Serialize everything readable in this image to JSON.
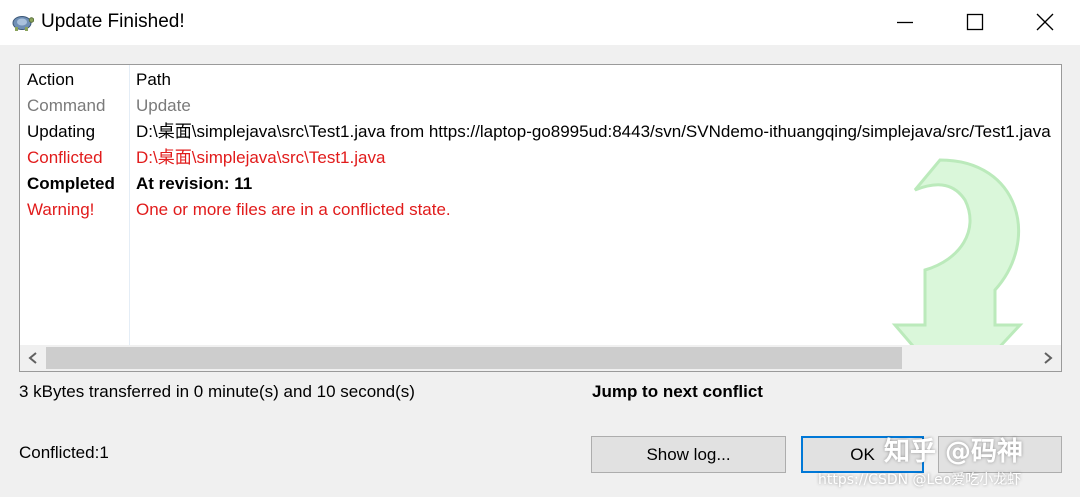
{
  "window": {
    "title": "Update Finished!",
    "controls": {
      "minimize": "minimize-icon",
      "maximize": "maximize-icon",
      "close": "close-icon"
    }
  },
  "list": {
    "headers": {
      "action": "Action",
      "path": "Path"
    },
    "rows": [
      {
        "action": "Command",
        "path": "Update",
        "color": "#7a7a7a",
        "bold": false
      },
      {
        "action": "Updating",
        "path": "D:\\桌面\\simplejava\\src\\Test1.java from https://laptop-go8995ud:8443/svn/SVNdemo-ithuangqing/simplejava/src/Test1.java",
        "color": "#000000",
        "bold": false
      },
      {
        "action": "Conflicted",
        "path": "D:\\桌面\\simplejava\\src\\Test1.java",
        "color": "#e11b1b",
        "bold": false
      },
      {
        "action": "Completed",
        "path": "At revision: 11",
        "color": "#000000",
        "bold": true
      },
      {
        "action": "Warning!",
        "path": "One or more files are in a conflicted state.",
        "color": "#e11b1b",
        "bold": false
      }
    ],
    "scroll": {
      "left": "scroll-left-icon",
      "right": "scroll-right-icon"
    }
  },
  "status": {
    "transfer": "3 kBytes transferred in 0 minute(s) and 10 second(s)",
    "jump_link": "Jump to next conflict",
    "conflicted_count": "Conflicted:1"
  },
  "buttons": {
    "show_log": "Show log...",
    "ok": "OK"
  },
  "watermark": {
    "line1": "知乎 @码神",
    "line2": "https://CSDN @Leo爱吃小龙虾"
  },
  "colors": {
    "accent": "#0078d7",
    "error": "#e11b1b",
    "arrow": "#c8f5c8"
  }
}
